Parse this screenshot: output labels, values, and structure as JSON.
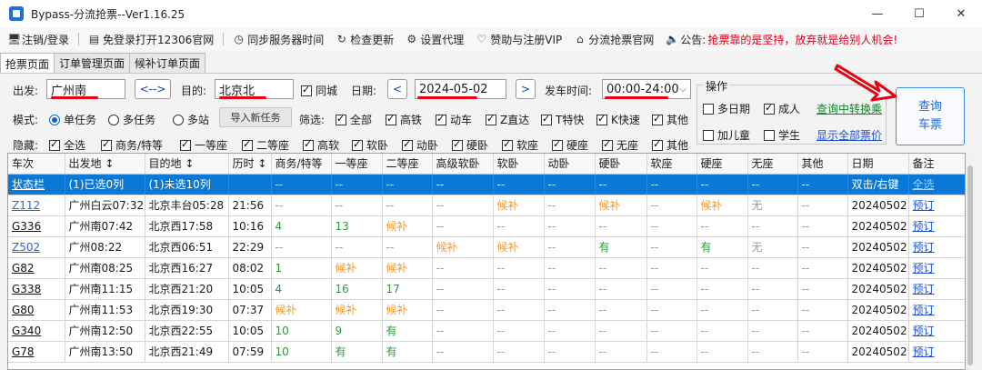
{
  "window": {
    "title": "Bypass-分流抢票--Ver1.16.25",
    "min": "—",
    "max": "☐",
    "close": "✕"
  },
  "menu": {
    "items": [
      {
        "icon": "monitor-icon",
        "glyph": "🖥",
        "label": "注销/登录"
      },
      {
        "icon": "window-icon",
        "glyph": "▤",
        "label": "免登录打开12306官网"
      },
      {
        "icon": "clock-icon",
        "glyph": "◷",
        "label": "同步服务器时间"
      },
      {
        "icon": "refresh-icon",
        "glyph": "↻",
        "label": "检查更新"
      },
      {
        "icon": "gear-icon",
        "glyph": "⚙",
        "label": "设置代理"
      },
      {
        "icon": "heart-icon",
        "glyph": "♡",
        "label": "赞助与注册VIP"
      },
      {
        "icon": "home-icon",
        "glyph": "⌂",
        "label": "分流抢票官网"
      }
    ],
    "notice_icon": "speaker-icon",
    "notice_label": "公告:",
    "notice_text": "抢票靠的是坚持，放弃就是给别人机会!"
  },
  "tabs": [
    "抢票页面",
    "订单管理页面",
    "候补订单页面"
  ],
  "filters": {
    "from_label": "出发:",
    "from_value": "广州南",
    "swap_label": "<-->",
    "to_label": "目的:",
    "to_value": "北京北",
    "same_city_label": "同城",
    "date_label": "日期:",
    "date_value": "2024-05-02",
    "prev": "<",
    "next": ">",
    "time_label": "发车时间:",
    "time_value": "00:00-24:00",
    "mode_label": "模式:",
    "modes": [
      "单任务",
      "多任务",
      "多站"
    ],
    "import_label": "导入新任务",
    "filter_label": "筛选:",
    "train_types": [
      "全部",
      "高铁",
      "动车",
      "Z直达",
      "T特快",
      "K快速",
      "其他"
    ],
    "hide_label": "隐藏:",
    "seat_types": [
      "全选",
      "商务/特等",
      "一等座",
      "二等座",
      "高软",
      "软卧",
      "动卧",
      "硬卧",
      "软座",
      "硬座",
      "无座",
      "其他"
    ]
  },
  "operation": {
    "title": "操作",
    "multi_date": "多日期",
    "adult": "成人",
    "transfer_link": "查询中转换乘",
    "add_child": "加儿童",
    "student": "学生",
    "show_prices_link": "显示全部票价",
    "query_line1": "查询",
    "query_line2": "车票"
  },
  "table": {
    "headers": [
      "车次",
      "出发地 ↕",
      "目的地 ↕",
      "历时 ↕",
      "商务/特等",
      "一等座",
      "二等座",
      "高级软卧",
      "软卧",
      "动卧",
      "硬卧",
      "软座",
      "硬座",
      "无座",
      "其他",
      "日期",
      "备注"
    ],
    "rows": [
      [
        "状态栏",
        "(1)已选0列",
        "(1)未选10列",
        "",
        "--",
        "--",
        "--",
        "--",
        "--",
        "--",
        "--",
        "--",
        "--",
        "--",
        "--",
        "双击/右键",
        "全选"
      ],
      [
        "Z112",
        "广州白云07:32",
        "北京丰台05:28",
        "21:56",
        "--",
        "--",
        "--",
        "--",
        "候补",
        "--",
        "候补",
        "--",
        "候补",
        "无",
        "--",
        "20240502",
        "预订"
      ],
      [
        "G336",
        "广州南07:42",
        "北京西17:58",
        "10:16",
        "4",
        "13",
        "候补",
        "--",
        "--",
        "--",
        "--",
        "--",
        "--",
        "--",
        "--",
        "20240502",
        "预订"
      ],
      [
        "Z502",
        "广州08:22",
        "北京西06:51",
        "22:29",
        "--",
        "--",
        "--",
        "候补",
        "候补",
        "--",
        "有",
        "--",
        "有",
        "无",
        "--",
        "20240502",
        "预订"
      ],
      [
        "G82",
        "广州南08:25",
        "北京西16:27",
        "08:02",
        "1",
        "候补",
        "候补",
        "--",
        "--",
        "--",
        "--",
        "--",
        "--",
        "--",
        "--",
        "20240502",
        "预订"
      ],
      [
        "G338",
        "广州南11:15",
        "北京西21:20",
        "10:05",
        "4",
        "16",
        "17",
        "--",
        "--",
        "--",
        "--",
        "--",
        "--",
        "--",
        "--",
        "20240502",
        "预订"
      ],
      [
        "G80",
        "广州南11:53",
        "北京西19:30",
        "07:37",
        "候补",
        "候补",
        "候补",
        "--",
        "--",
        "--",
        "--",
        "--",
        "--",
        "--",
        "--",
        "20240502",
        "预订"
      ],
      [
        "G340",
        "广州南12:50",
        "北京西22:55",
        "10:05",
        "10",
        "9",
        "有",
        "--",
        "--",
        "--",
        "--",
        "--",
        "--",
        "--",
        "--",
        "20240502",
        "预订"
      ],
      [
        "G78",
        "广州南13:50",
        "北京西21:49",
        "07:59",
        "10",
        "有",
        "有",
        "--",
        "--",
        "--",
        "--",
        "--",
        "--",
        "--",
        "--",
        "20240502",
        "预订"
      ]
    ]
  },
  "colors": {
    "accent": "#0a78d7",
    "available": "#2e9b39",
    "waitlist": "#f39a2a",
    "notice": "#e0001a"
  }
}
